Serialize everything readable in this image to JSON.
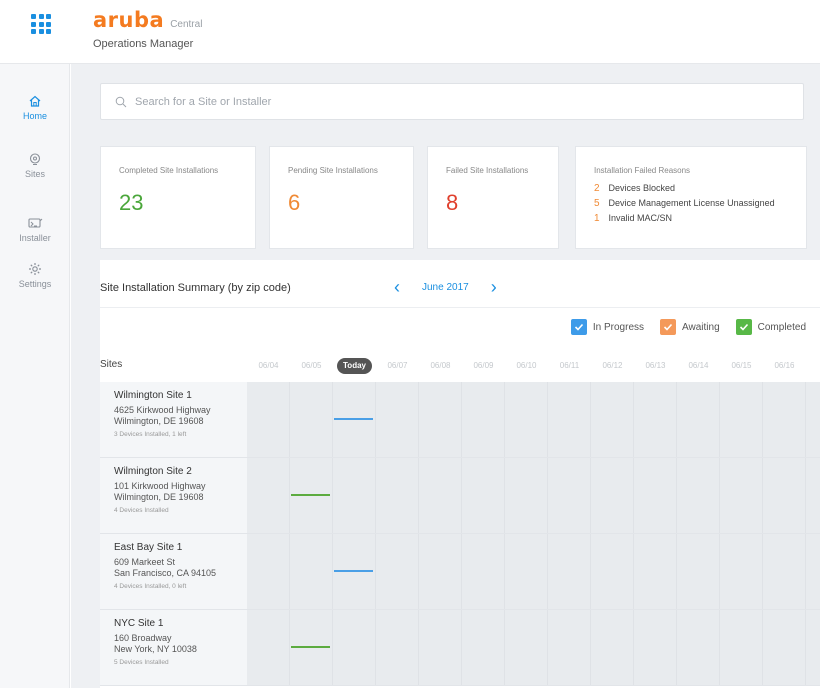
{
  "header": {
    "logo_text": "aruba",
    "product_name": "Central",
    "page_title": "Operations Manager"
  },
  "sidebar": {
    "items": [
      {
        "label": "Home",
        "icon": "home-icon",
        "active": true
      },
      {
        "label": "Sites",
        "icon": "location-pin-icon",
        "active": false
      },
      {
        "label": "Installer",
        "icon": "installer-icon",
        "active": false
      },
      {
        "label": "Settings",
        "icon": "gear-icon",
        "active": false
      }
    ]
  },
  "search": {
    "placeholder": "Search for a Site or Installer"
  },
  "cards": {
    "completed": {
      "title": "Completed Site Installations",
      "value": "23"
    },
    "pending": {
      "title": "Pending Site Installations",
      "value": "6"
    },
    "failed": {
      "title": "Failed Site Installations",
      "value": "8"
    },
    "reasons": {
      "title": "Installation Failed Reasons",
      "items": [
        {
          "count": "2",
          "label": "Devices Blocked"
        },
        {
          "count": "5",
          "label": "Device Management License Unassigned"
        },
        {
          "count": "1",
          "label": "Invalid MAC/SN"
        }
      ]
    }
  },
  "summary": {
    "title": "Site Installation Summary (by zip code)",
    "month": "June 2017",
    "prev_icon": "chevron-left-icon",
    "next_icon": "chevron-right-icon",
    "legend": [
      {
        "label": "In Progress",
        "color": "#3d9be9"
      },
      {
        "label": "Awaiting",
        "color": "#f4995a"
      },
      {
        "label": "Completed",
        "color": "#58b847"
      }
    ],
    "sites_header": "Sites",
    "dates": [
      "06/04",
      "06/05",
      "Today",
      "06/07",
      "06/08",
      "06/09",
      "06/10",
      "06/11",
      "06/12",
      "06/13",
      "06/14",
      "06/15",
      "06/16"
    ],
    "sites": [
      {
        "name": "Wilmington Site 1",
        "addr1": "4625 Kirkwood Highway",
        "addr2": "Wilmington, DE 19608",
        "status": "3 Devices Installed, 1 left",
        "bar_status": "In Progress",
        "bar_date": "Today",
        "bar_color": "#4a9fe6"
      },
      {
        "name": "Wilmington Site 2",
        "addr1": "101 Kirkwood Highway",
        "addr2": "Wilmington, DE 19608",
        "status": "4 Devices Installed",
        "bar_status": "Completed",
        "bar_date": "06/05",
        "bar_color": "#5cab3f"
      },
      {
        "name": "East Bay Site 1",
        "addr1": "609 Markeet St",
        "addr2": "San Francisco, CA 94105",
        "status": "4 Devices Installed, 0 left",
        "bar_status": "In Progress",
        "bar_date": "Today",
        "bar_color": "#4a9fe6"
      },
      {
        "name": "NYC Site 1",
        "addr1": "160 Broadway",
        "addr2": "New York, NY 10038",
        "status": "5 Devices Installed",
        "bar_status": "Completed",
        "bar_date": "06/05",
        "bar_color": "#5cab3f"
      }
    ]
  }
}
